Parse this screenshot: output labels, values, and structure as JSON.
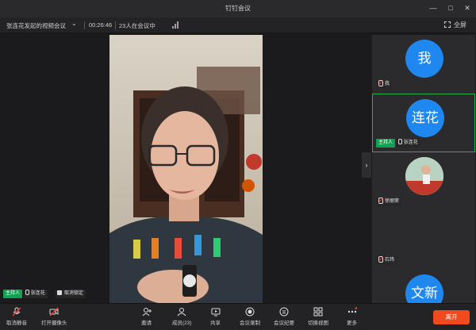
{
  "window": {
    "title": "钉钉会议"
  },
  "info_bar": {
    "meeting_title": "张连花发起的视频会议",
    "timer": "00:26:46",
    "participant_count": "23人在会议中",
    "fullscreen_label": "全屏"
  },
  "main_video": {
    "tags": {
      "host": "主持人",
      "speaker": "张连花",
      "lock": "取消锁定"
    }
  },
  "sidebar": {
    "tiles": [
      {
        "avatar_text": "我",
        "name": "我"
      },
      {
        "avatar_text": "连花",
        "name": "张连花",
        "host": "主持人"
      },
      {
        "name": "徐丽荣"
      },
      {
        "name": "石玮"
      },
      {
        "avatar_text": "文新"
      }
    ]
  },
  "toolbar": {
    "buttons": [
      {
        "label": "取消静音"
      },
      {
        "label": "打开摄像头"
      },
      {
        "label": "邀请"
      },
      {
        "label": "成员(23)"
      },
      {
        "label": "共享"
      },
      {
        "label": "会议录制"
      },
      {
        "label": "会议纪要"
      },
      {
        "label": "切换视图"
      },
      {
        "label": "更多"
      }
    ],
    "leave_label": "离开"
  },
  "colors": {
    "accent_blue": "#1e88f0",
    "host_green": "#12a150",
    "active_border": "#25b24a",
    "leave_red": "#f04a1e",
    "mute_red": "#ff3b30"
  }
}
